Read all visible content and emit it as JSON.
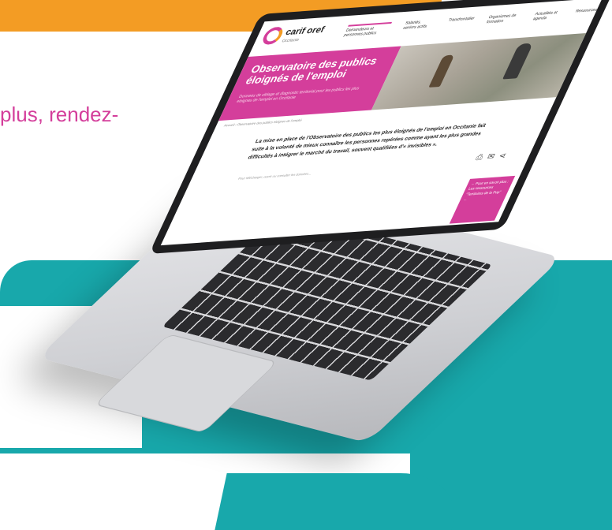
{
  "background": {
    "colors": {
      "orange": "#f39c24",
      "teal": "#18a8ab",
      "pink": "#d43e9b"
    }
  },
  "intro": {
    "text": "plus, rendez-"
  },
  "screen": {
    "logo": {
      "name": "carif oref",
      "sub": "Occitanie"
    },
    "nav": [
      "Demandeurs et personnes publics",
      "Salariés, seniors actifs",
      "Transfrontalier",
      "Organismes de formation",
      "Actualités et agenda",
      "Ressources"
    ],
    "hero_title": "Observatoire des publics éloignés de l'emploi",
    "hero_subtitle": "Donnees de ciblage et diagnostic territorial pour les publics les plus eloignes de l'emploi en Occitanie",
    "breadcrumb": "Accueil › Observatoire des publics eloignes de l'emploi",
    "body": "La mise en place de l'Observatoire des publics les plus éloignés de l'emploi en Occitanie fait suite à la volonté de mieux connaître les personnes repérées comme ayant les plus grandes difficultés à intégrer le marché du travail, souvent qualifiées d'« invisibles ».",
    "note": "Pour télécharger, ouvrir ou consulter les données...",
    "tools": [
      "print-icon",
      "mail-icon",
      "share-icon"
    ],
    "cta": "Pour en savoir plus : Les ressources \"Territoires de la Pop\" ..."
  }
}
